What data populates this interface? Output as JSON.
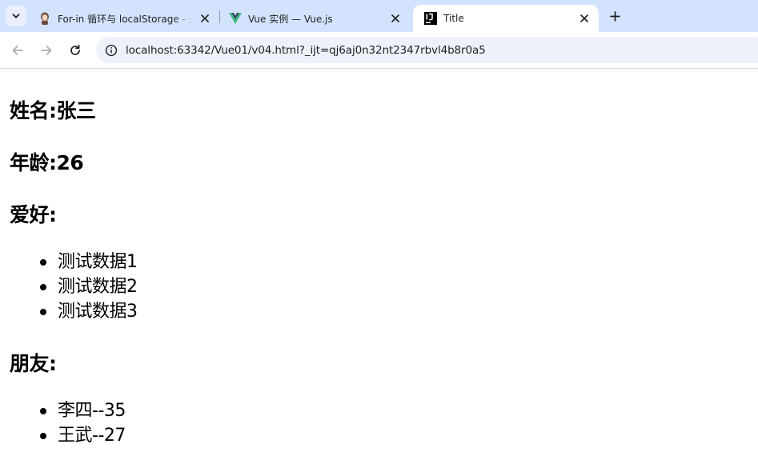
{
  "browser": {
    "tabs": [
      {
        "label": "For-in 循环与 localStorage - 王",
        "favicon": "avatar-icon",
        "active": false
      },
      {
        "label": "Vue 实例 — Vue.js",
        "favicon": "vue-logo-icon",
        "active": false
      },
      {
        "label": "Title",
        "favicon": "intellij-icon",
        "active": true
      }
    ],
    "address_bar": {
      "url": "localhost:63342/Vue01/v04.html?_ijt=qj6aj0n32nt2347rbvl4b8r0a5"
    }
  },
  "page": {
    "name_line": "姓名:张三",
    "age_line": "年龄:26",
    "hobbies_heading": "爱好:",
    "hobbies": [
      "测试数据1",
      "测试数据2",
      "测试数据3"
    ],
    "friends_heading": "朋友:",
    "friends": [
      "李四--35",
      "王武--27"
    ]
  }
}
